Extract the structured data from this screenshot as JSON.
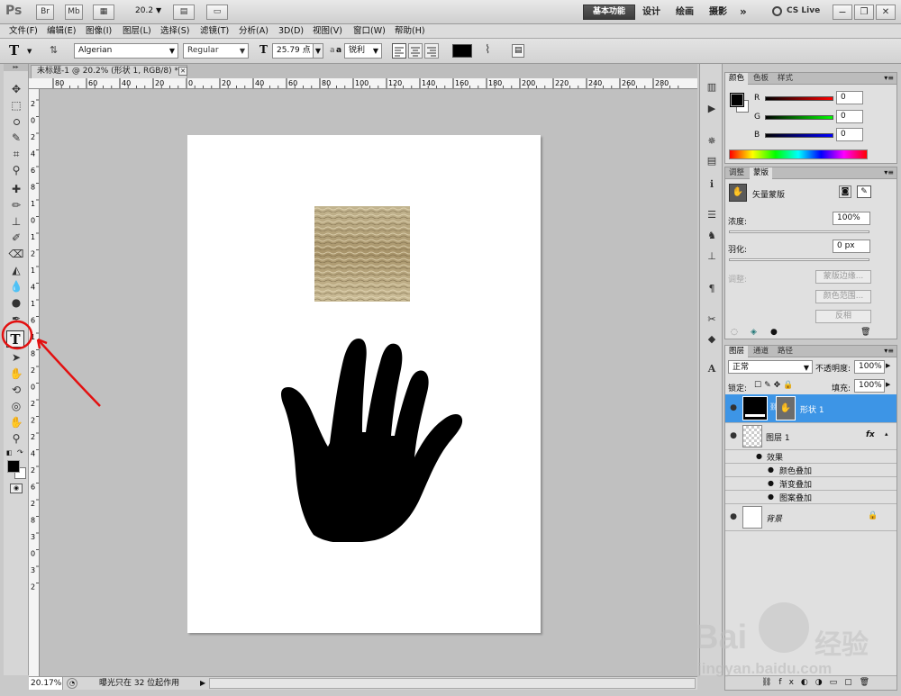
{
  "appbar": {
    "logo": "Ps",
    "br_label": "Br",
    "mb_label": "Mb",
    "zoom_value": "20.2",
    "workspaces": [
      "基本功能",
      "设计",
      "绘画",
      "摄影"
    ],
    "more": "»",
    "cslive": "CS Live"
  },
  "menu": [
    "文件(F)",
    "编辑(E)",
    "图像(I)",
    "图层(L)",
    "选择(S)",
    "滤镜(T)",
    "分析(A)",
    "3D(D)",
    "视图(V)",
    "窗口(W)",
    "帮助(H)"
  ],
  "options": {
    "tool_glyph": "T",
    "font_family": "Algerian",
    "font_style": "Regular",
    "font_size": "25.79 点",
    "aa_prefix": "a",
    "aa_mode": "锐利",
    "text_color": "#000000"
  },
  "document": {
    "tab_title": "未标题-1 @ 20.2% (形状 1, RGB/8) *",
    "zoom": "20.17%",
    "status_text": "曝光只在 32 位起作用"
  },
  "rulers": {
    "h": [
      "80",
      "60",
      "40",
      "20",
      "0",
      "20",
      "40",
      "60",
      "80",
      "100",
      "120",
      "140",
      "160",
      "180",
      "200",
      "220",
      "240",
      "260",
      "280"
    ],
    "v": [
      "2",
      "0",
      "2",
      "4",
      "6",
      "8",
      "1",
      "0",
      "1",
      "2",
      "1",
      "4",
      "1",
      "6",
      "1",
      "8",
      "2",
      "0",
      "2",
      "2",
      "2",
      "4",
      "2",
      "6",
      "2",
      "8",
      "3",
      "0",
      "3",
      "2"
    ]
  },
  "color_panel": {
    "tabs": [
      "颜色",
      "色板",
      "样式"
    ],
    "labels": [
      "R",
      "G",
      "B"
    ],
    "values": [
      "0",
      "0",
      "0"
    ],
    "fg": "#000000",
    "bg": "#ffffff"
  },
  "masks_panel": {
    "tabs": [
      "调整",
      "蒙版"
    ],
    "title": "矢量蒙版",
    "density_label": "浓度:",
    "density_value": "100%",
    "feather_label": "羽化:",
    "feather_value": "0 px",
    "adjust_label": "调整:",
    "buttons": [
      "蒙版边缘...",
      "颜色范围...",
      "反相"
    ]
  },
  "layers_panel": {
    "tabs": [
      "图层",
      "通道",
      "路径"
    ],
    "blend_mode": "正常",
    "opacity_label": "不透明度:",
    "opacity_value": "100%",
    "lock_label": "锁定:",
    "fill_label": "填充:",
    "fill_value": "100%",
    "layers": [
      {
        "name": "形状 1",
        "selected": true
      },
      {
        "name": "图层 1",
        "fx": "fx",
        "effects_label": "效果",
        "effects": [
          "颜色叠加",
          "渐变叠加",
          "图案叠加"
        ]
      },
      {
        "name": "背景",
        "italic": true
      }
    ]
  },
  "watermark": {
    "brand": "Bai",
    "brand_cn": "经验",
    "url": "jingyan.baidu.com"
  },
  "accent": "#3d95e6"
}
